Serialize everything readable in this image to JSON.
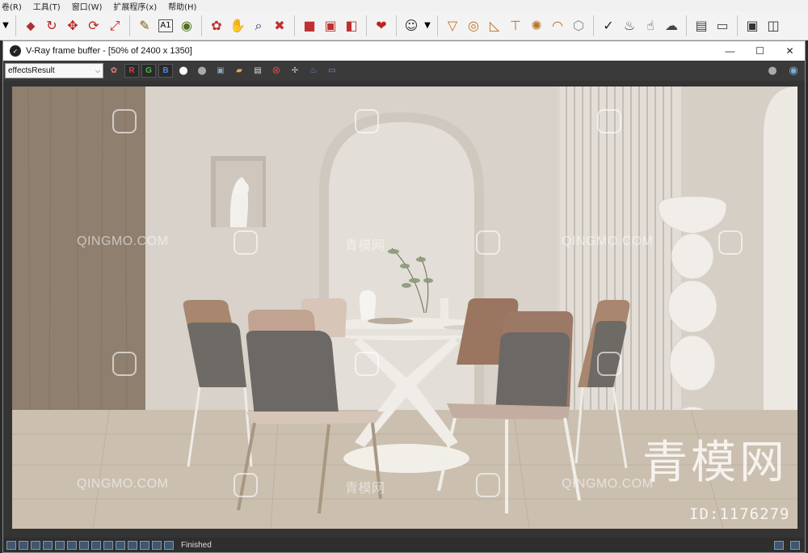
{
  "menu": {
    "items": [
      "卷(R)",
      "工具(T)",
      "窗口(W)",
      "扩展程序(x)",
      "帮助(H)"
    ]
  },
  "vfb": {
    "title": "V-Ray frame buffer - [50% of 2400 x 1350]",
    "channel": "effectsResult",
    "r_label": "R",
    "g_label": "G",
    "b_label": "B",
    "status": "Finished"
  },
  "watermarks": {
    "site_latin": "QINGMO.COM",
    "site_cn": "青模网",
    "big_cn": "青模网",
    "id_text": "ID:1176279"
  },
  "colors": {
    "r_channel": "#e04040",
    "g_channel": "#40c040",
    "b_channel": "#5080f0",
    "wall": "#d8d2ca",
    "floor": "#cbbfb0",
    "wood_panel": "#8a7b6a"
  }
}
